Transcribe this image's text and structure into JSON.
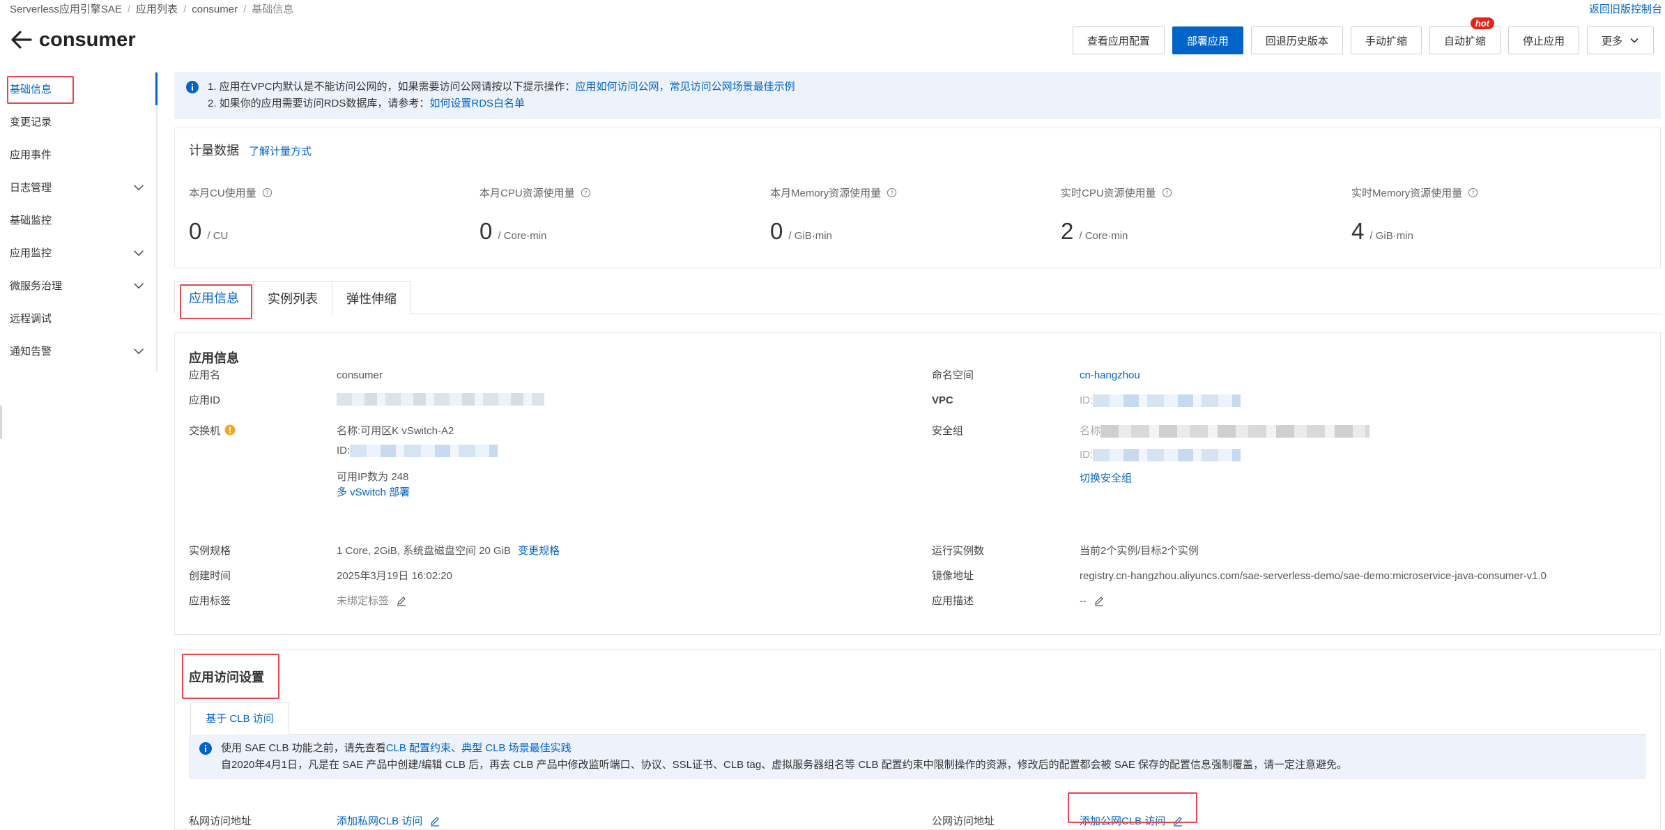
{
  "breadcrumb": [
    "Serverless应用引擎SAE",
    "应用列表",
    "consumer",
    "基础信息"
  ],
  "return_link": "返回旧版控制台",
  "page_title": "consumer",
  "toolbar": {
    "view_config": "查看应用配置",
    "deploy": "部署应用",
    "rollback": "回退历史版本",
    "manual_scale": "手动扩缩",
    "auto_scale": "自动扩缩",
    "hot_badge": "hot",
    "stop": "停止应用",
    "more": "更多"
  },
  "sidebar": {
    "items": [
      {
        "label": "基础信息"
      },
      {
        "label": "变更记录"
      },
      {
        "label": "应用事件"
      },
      {
        "label": "日志管理"
      },
      {
        "label": "基础监控"
      },
      {
        "label": "应用监控"
      },
      {
        "label": "微服务治理"
      },
      {
        "label": "远程调试"
      },
      {
        "label": "通知告警"
      }
    ]
  },
  "notice": {
    "line1_prefix": "1. 应用在VPC内默认是不能访问公网的，如果需要访问公网请按以下提示操作：",
    "line1_link1": "应用如何访问公网",
    "line1_sep": "，",
    "line1_link2": "常见访问公网场景最佳示例",
    "line2_prefix": "2. 如果你的应用需要访问RDS数据库，请参考：",
    "line2_link": "如何设置RDS白名单"
  },
  "metrics": {
    "title": "计量数据",
    "learn_link": "了解计量方式",
    "items": [
      {
        "label": "本月CU使用量",
        "value": "0",
        "unit": "/ CU"
      },
      {
        "label": "本月CPU资源使用量",
        "value": "0",
        "unit": "/ Core·min"
      },
      {
        "label": "本月Memory资源使用量",
        "value": "0",
        "unit": "/ GiB·min"
      },
      {
        "label": "实时CPU资源使用量",
        "value": "2",
        "unit": "/ Core·min"
      },
      {
        "label": "实时Memory资源使用量",
        "value": "4",
        "unit": "/ GiB·min"
      }
    ]
  },
  "tabs": [
    "应用信息",
    "实例列表",
    "弹性伸缩"
  ],
  "app_info": {
    "title": "应用信息",
    "name_label": "应用名",
    "name_value": "consumer",
    "id_label": "应用ID",
    "namespace_label": "命名空间",
    "namespace_value": "cn-hangzhou",
    "vpc_label": "VPC",
    "vpc_prefix": "ID:",
    "vswitch_label": "交换机",
    "vswitch_name": "名称:可用区K vSwitch-A2",
    "vswitch_id_prefix": "ID:",
    "vswitch_ip": "可用IP数为 248",
    "vswitch_multi_link": "多 vSwitch 部署",
    "sg_label": "安全组",
    "sg_name_prefix": "名称",
    "sg_id_prefix": "ID:",
    "sg_switch_link": "切换安全组",
    "spec_label": "实例规格",
    "spec_value": "1 Core, 2GiB, 系统盘磁盘空间 20 GiB",
    "spec_change_link": "变更规格",
    "running_label": "运行实例数",
    "running_value": "当前2个实例/目标2个实例",
    "created_label": "创建时间",
    "created_value": "2025年3月19日 16:02:20",
    "image_label": "镜像地址",
    "image_value": "registry.cn-hangzhou.aliyuncs.com/sae-serverless-demo/sae-demo:microservice-java-consumer-v1.0",
    "tag_label": "应用标签",
    "tag_value": "未绑定标签",
    "desc_label": "应用描述",
    "desc_value": "--"
  },
  "access": {
    "title": "应用访问设置",
    "tab": "基于 CLB 访问",
    "notice_line1_prefix": "使用 SAE CLB 功能之前，请先查看",
    "notice_line1_link1": "CLB 配置约束",
    "notice_line1_sep": "、",
    "notice_line1_link2": "典型 CLB 场景最佳实践",
    "notice_line2": "自2020年4月1日，凡是在 SAE 产品中创建/编辑 CLB 后，再去 CLB 产品中修改监听端口、协议、SSL证书、CLB tag、虚拟服务器组名等 CLB 配置约束中限制操作的资源，修改后的配置都会被 SAE 保存的配置信息强制覆盖，请一定注意避免。",
    "private_label": "私网访问地址",
    "private_link": "添加私网CLB 访问",
    "public_label": "公网访问地址",
    "public_link": "添加公网CLB 访问"
  }
}
